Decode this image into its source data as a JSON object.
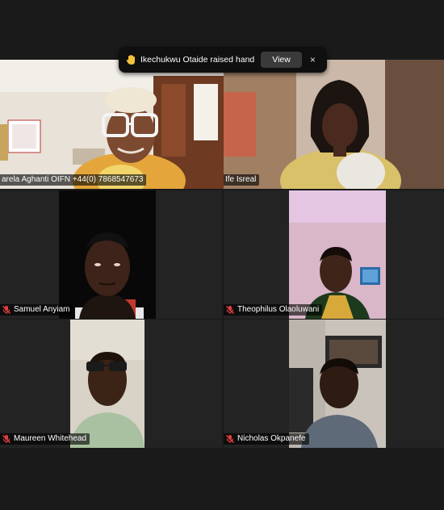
{
  "notification": {
    "message": "Ikechukwu Otaide raised hand",
    "view_label": "View",
    "close_glyph": "×",
    "icon": "raised-hand-icon"
  },
  "participants": [
    {
      "name": "arela Aghanti OIFN +44(0) 7868547673",
      "muted": false,
      "active_speaker": true
    },
    {
      "name": "Ife Isreal",
      "muted": false,
      "active_speaker": false
    },
    {
      "name": "Samuel Anyiam",
      "muted": true,
      "active_speaker": false
    },
    {
      "name": "Theophilus Olaoluwani",
      "muted": true,
      "active_speaker": false
    },
    {
      "name": "Maureen Whitehead",
      "muted": true,
      "active_speaker": false
    },
    {
      "name": "Nicholas Okpanefe",
      "muted": true,
      "active_speaker": false
    }
  ],
  "colors": {
    "background": "#1a1a1a",
    "active_speaker_border": "#2ecc71",
    "muted_mic": "#e03e3e"
  }
}
